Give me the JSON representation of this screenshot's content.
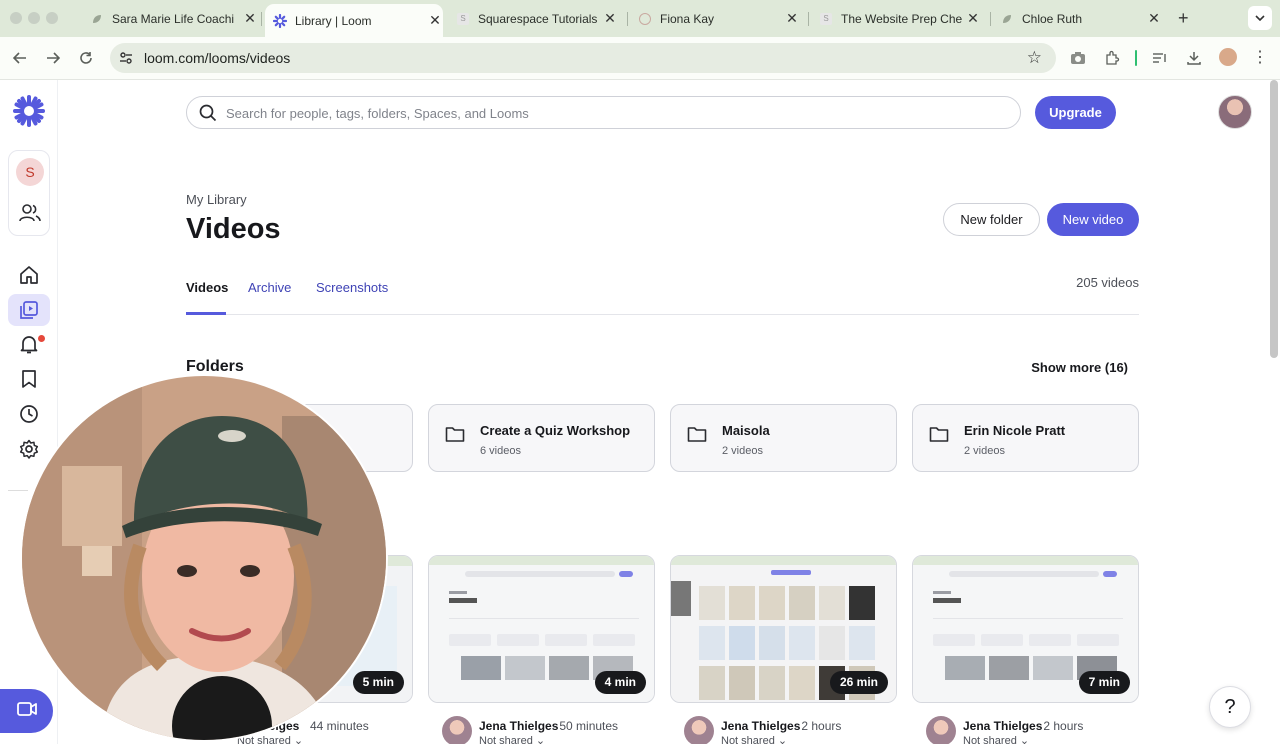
{
  "browser": {
    "tabs": [
      {
        "title": "Sara Marie Life Coachi",
        "favicon": "leaf-icon"
      },
      {
        "title": "Library | Loom",
        "favicon": "loom-icon",
        "active": true
      },
      {
        "title": "Squarespace Tutorials",
        "favicon": "squarespace-icon"
      },
      {
        "title": "Fiona Kay",
        "favicon": "circle-icon"
      },
      {
        "title": "The Website Prep Che",
        "favicon": "squarespace-icon"
      },
      {
        "title": "Chloe Ruth",
        "favicon": "leaf-icon"
      }
    ],
    "url": "loom.com/looms/videos"
  },
  "header": {
    "search_placeholder": "Search for people, tags, folders, Spaces, and Looms",
    "upgrade_label": "Upgrade"
  },
  "sidebar": {
    "workspace_initial": "S",
    "items": [
      "home-icon",
      "library-icon",
      "bell-icon",
      "bookmark-icon",
      "clock-icon",
      "gear-icon"
    ]
  },
  "main": {
    "breadcrumb": "My Library",
    "title": "Videos",
    "new_folder_label": "New folder",
    "new_video_label": "New video",
    "tabs": [
      {
        "label": "Videos",
        "active": true
      },
      {
        "label": "Archive"
      },
      {
        "label": "Screenshots"
      }
    ],
    "video_count": "205 videos",
    "folders_title": "Folders",
    "show_more_label": "Show more (16)",
    "folders": [
      {
        "name": "Create a Quiz Workshop",
        "count": "6 videos"
      },
      {
        "name": "Maisola",
        "count": "2 videos"
      },
      {
        "name": "Erin Nicole Pratt",
        "count": "2 videos"
      }
    ],
    "videos": [
      {
        "duration": "5 min",
        "author": "Jena Thielges",
        "partial_author": "hielges",
        "time": "44 minutes",
        "sharing": "Not shared"
      },
      {
        "duration": "4 min",
        "author": "Jena Thielges",
        "time": "50 minutes",
        "sharing": "Not shared"
      },
      {
        "duration": "26 min",
        "author": "Jena Thielges",
        "time": "2 hours",
        "sharing": "Not shared"
      },
      {
        "duration": "7 min",
        "author": "Jena Thielges",
        "time": "2 hours",
        "sharing": "Not shared"
      }
    ]
  },
  "help_label": "?",
  "colors": {
    "accent": "#565add",
    "tabbar": "#dfe9d9"
  }
}
